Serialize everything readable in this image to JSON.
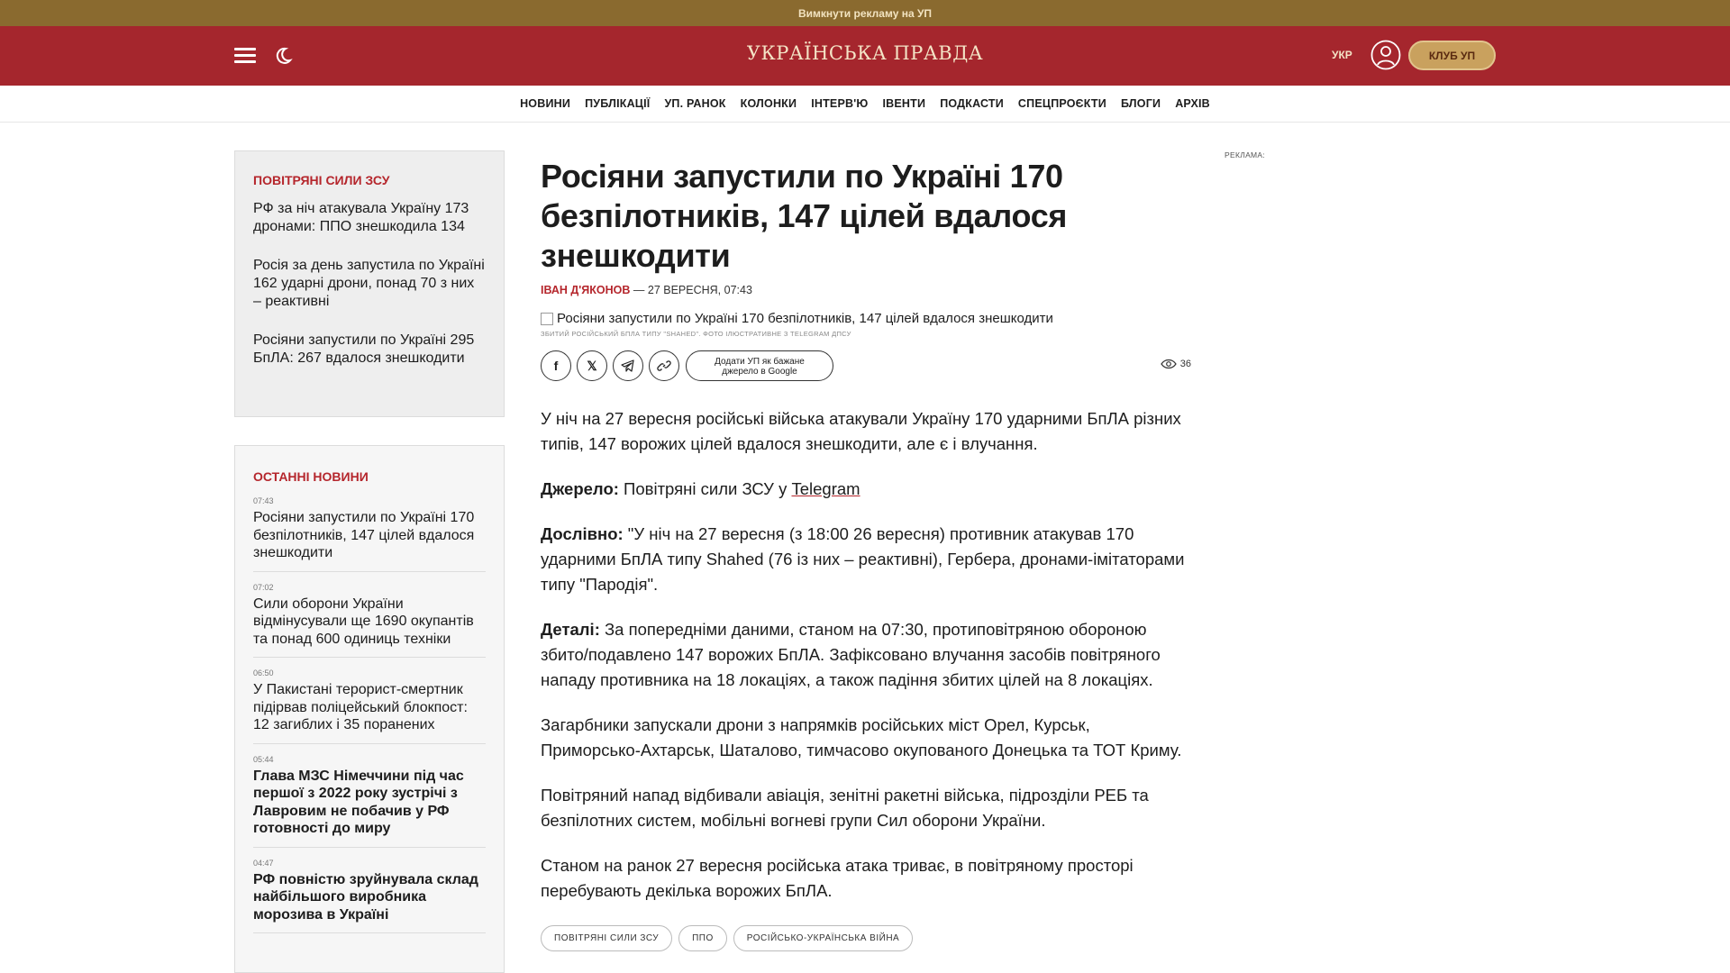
{
  "promo": {
    "text": "Вимкнути рекламу на УП"
  },
  "header": {
    "logo": "УКРАЇНСЬКА ПРАВДА",
    "lang": "УКР",
    "club_button": "КЛУБ УП"
  },
  "nav": [
    "НОВИНИ",
    "ПУБЛІКАЦІЇ",
    "УП. РАНОК",
    "КОЛОНКИ",
    "ІНТЕРВ'Ю",
    "ІВЕНТИ",
    "ПОДКАСТИ",
    "СПЕЦПРОЄКТИ",
    "БЛОГИ",
    "АРХІВ"
  ],
  "sidebar_related": {
    "title": "ПОВІТРЯНІ СИЛИ ЗСУ",
    "items": [
      "РФ за ніч атакувала Україну 173 дронами: ППО знешкодила 134",
      "Росія за день запустила по Україні 162 ударні дрони, понад 70 з них – реактивні",
      "Росіяни запустили по Україні 295 БпЛА: 267 вдалося знешкодити"
    ]
  },
  "sidebar_latest": {
    "title": "ОСТАННІ НОВИНИ",
    "items": [
      {
        "time": "07:43",
        "title": "Росіяни запустили по Україні 170 безпілотників, 147 цілей вдалося знешкодити",
        "bold": false
      },
      {
        "time": "07:02",
        "title": "Сили оборони України відмінусували ще 1690 окупантів та понад 600 одиниць техніки",
        "bold": false
      },
      {
        "time": "06:50",
        "title": "У Пакистані терорист-смертник підірвав поліцейський блокпост: 12 загиблих і 35 поранених",
        "bold": false
      },
      {
        "time": "05:44",
        "title": "Глава МЗС Німеччини під час першої з 2022 року зустрічі з Лавровим не побачив у РФ готовності до миру",
        "bold": true
      },
      {
        "time": "04:47",
        "title": "РФ повністю зруйнувала склад найбільшого виробника морозива в Україні",
        "bold": true
      }
    ]
  },
  "article": {
    "title": "Росіяни запустили по Україні 170 безпілотників, 147 цілей вдалося знешкодити",
    "author": "ІВАН Д'ЯКОНОВ",
    "date": "— 27 ВЕРЕСНЯ, 07:43",
    "image_alt": "Росіяни запустили по Україні 170 безпілотників, 147 цілей вдалося знешкодити",
    "caption": "ЗБИТИЙ РОСІЙСЬКИЙ БПЛА ТИПУ \"SHAHED\". ФОТО ІЛЮСТРАТИВНЕ З TELEGRAM ДПСУ",
    "google_button_line1": "Додати УП як бажане",
    "google_button_line2": "джерело в Google",
    "views": "36",
    "lead": "У ніч на 27 вересня російські війська атакували Україну 170 ударними БпЛА різних типів, 147 ворожих цілей вдалося знешкодити, але є і влучання.",
    "source_label": "Джерело:",
    "source_text": "Повітряні сили ЗСУ у",
    "source_link": "Telegram",
    "quote_label": "Дослівно:",
    "quote_text": "\"У ніч на 27 вересня (з 18:00 26 вересня) противник атакував 170 ударними БпЛА типу Shahed (76 із них – реактивні), Гербера, дронами-імітаторами типу \"Пародія\".",
    "details_label": "Деталі:",
    "details_text": "За попередніми даними, станом на 07:30, протиповітряною обороною збито/подавлено 147 ворожих БпЛА. Зафіксовано влучання засобів повітряного нападу противника на 18 локаціях, а також падіння збитих цілей на 8 локаціях.",
    "p4": "Загарбники запускали дрони з напрямків російських міст Орел, Курськ, Приморсько-Ахтарськ, Шаталово, тимчасово окупованого Донецька та ТОТ Криму.",
    "p5": "Повітряний напад відбивали авіація, зенітні ракетні війська, підрозділи РЕБ та безпілотних систем, мобільні вогневі групи Сил оборони України.",
    "p6": "Станом на ранок 27 вересня російська атака триває, в повітряному просторі перебувають декілька ворожих БпЛА.",
    "tags": [
      "ПОВІТРЯНІ СИЛИ ЗСУ",
      "ППО",
      "РОСІЙСЬКО-УКРАЇНСЬКА ВІЙНА"
    ]
  },
  "ad_label": "РЕКЛАМА:",
  "colors": {
    "header_red": "#a5262d",
    "accent_red": "#b5262c",
    "promo_bg": "#8a6a2f",
    "club_gold": "#c9a15e"
  }
}
